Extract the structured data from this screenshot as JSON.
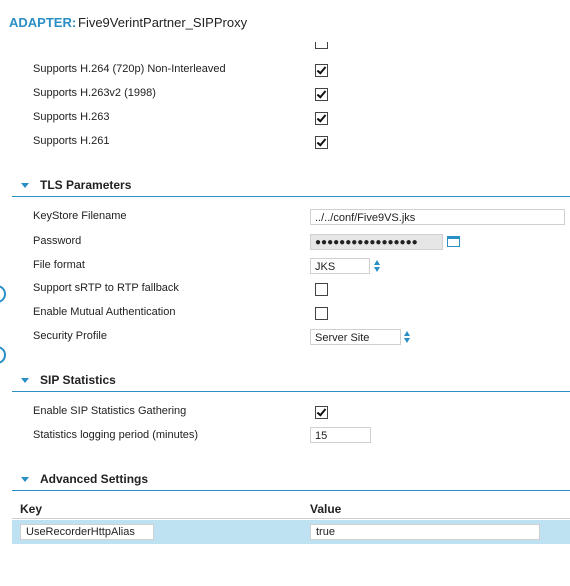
{
  "header": {
    "prefix": "ADAPTER:",
    "name": "Five9VerintPartner_SIPProxy"
  },
  "video": {
    "items": [
      {
        "label": "Supports H.264 (720p) Non-Interleaved",
        "checked": true
      },
      {
        "label": "Supports H.263v2 (1998)",
        "checked": true
      },
      {
        "label": "Supports H.263",
        "checked": true
      },
      {
        "label": "Supports H.261",
        "checked": true
      }
    ]
  },
  "tls": {
    "title": "TLS Parameters",
    "keystore_label": "KeyStore Filename",
    "keystore_value": "../../conf/Five9VS.jks",
    "password_label": "Password",
    "password_value": "●●●●●●●●●●●●●●●●●",
    "format_label": "File format",
    "format_value": "JKS",
    "srtp_label": "Support sRTP to RTP fallback",
    "srtp_checked": false,
    "mutual_label": "Enable Mutual Authentication",
    "mutual_checked": false,
    "profile_label": "Security Profile",
    "profile_value": "Server Site"
  },
  "sip": {
    "title": "SIP Statistics",
    "enable_label": "Enable SIP Statistics Gathering",
    "enable_checked": true,
    "period_label": "Statistics logging period (minutes)",
    "period_value": "15"
  },
  "advanced": {
    "title": "Advanced Settings",
    "key_header": "Key",
    "value_header": "Value",
    "rows": [
      {
        "key": "UseRecorderHttpAlias",
        "value": "true"
      }
    ]
  },
  "colors": {
    "accent": "#2a8fc4",
    "selected_row": "#bfe2f3"
  }
}
